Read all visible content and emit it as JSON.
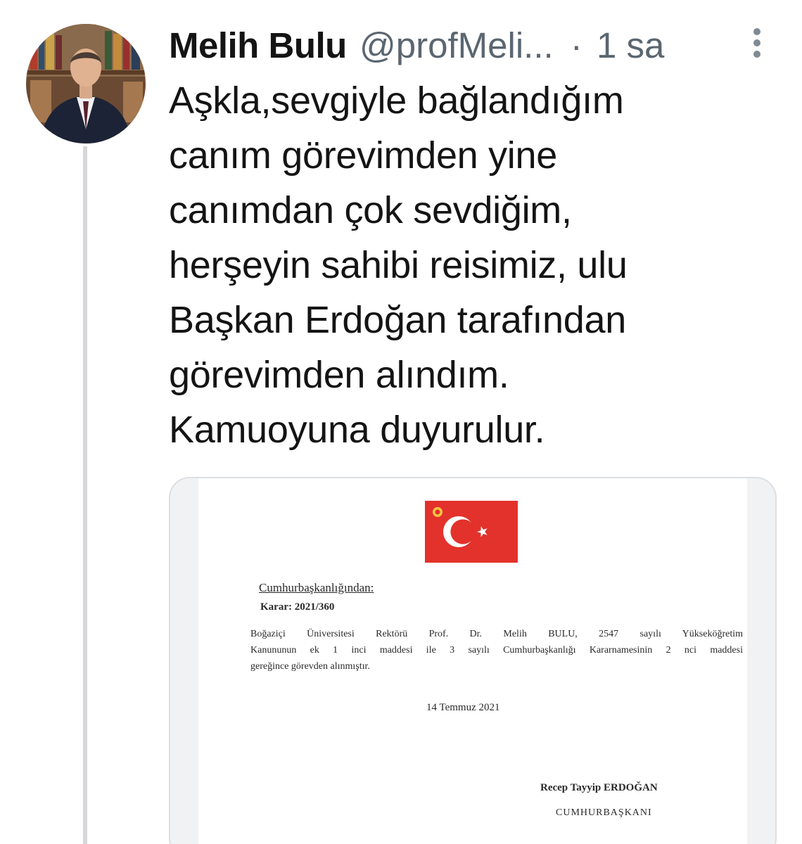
{
  "tweet": {
    "display_name": "Melih Bulu",
    "handle": "@profMeli...",
    "separator": "·",
    "time": "1 sa",
    "text_lines": [
      "Aşkla,sevgiyle bağlandığım",
      "canım görevimden yine",
      "canımdan çok sevdiğim,",
      "herşeyin sahibi reisimiz, ulu",
      "Başkan Erdoğan tarafından",
      "görevimden alındım.",
      "Kamuoyuna duyurulur."
    ]
  },
  "document": {
    "heading": "Cumhurbaşkanlığından:",
    "decree": "Karar: 2021/360",
    "body_lines": [
      "Boğaziçi Üniversitesi Rektörü Prof. Dr. Melih BULU, 2547 sayılı Yükseköğretim",
      "Kanununun ek 1 inci maddesi ile 3 sayılı Cumhurbaşkanlığı Kararnamesinin 2 nci maddesi",
      "gereğince görevden alınmıştır."
    ],
    "date": "14 Temmuz 2021",
    "signer": "Recep Tayyip ERDOĞAN",
    "signer_title": "CUMHURBAŞKANI"
  },
  "icons": {
    "more": "more-vertical-icon",
    "flag": "turkish-flag"
  },
  "colors": {
    "flag_red": "#e3322b",
    "secondary_text": "#5b6670",
    "thread_line": "#d5d7d9"
  }
}
